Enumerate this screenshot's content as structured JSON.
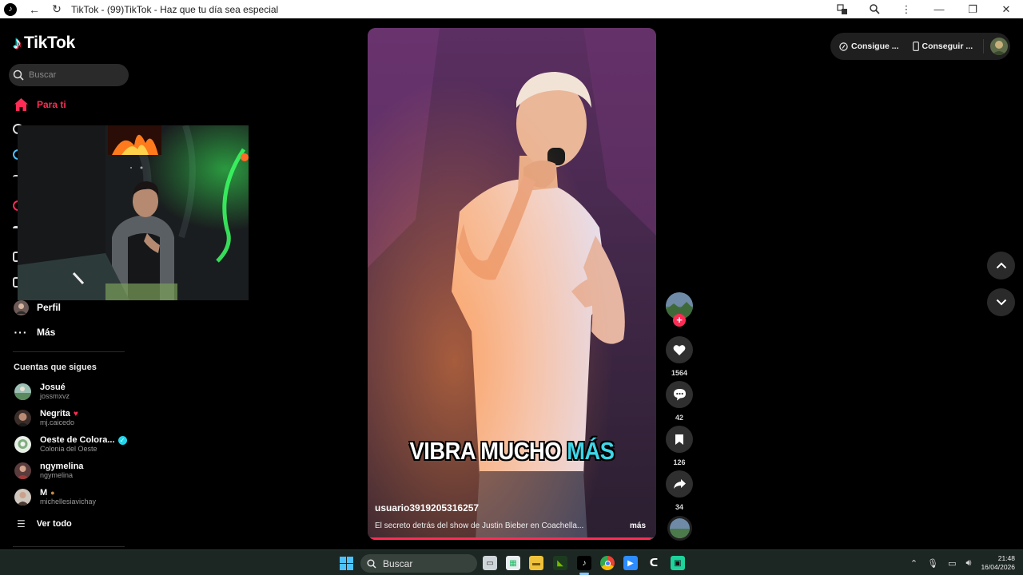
{
  "window": {
    "title": "TikTok - (99)TikTok - Haz que tu día sea especial"
  },
  "brand": {
    "name": "TikTok"
  },
  "search": {
    "placeholder": "Buscar"
  },
  "nav": {
    "for_you": "Para ti",
    "profile": "Perfil",
    "more": "Más"
  },
  "following": {
    "title": "Cuentas que sigues",
    "accounts": [
      {
        "name": "Josué",
        "username": "jossmxvz"
      },
      {
        "name": "Negrita",
        "username": "mj.caicedo"
      },
      {
        "name": "Oeste de Colora...",
        "username": "Colonia del Oeste"
      },
      {
        "name": "ngymelina",
        "username": "ngymelina"
      },
      {
        "name": "M",
        "username": "michellesiavichay"
      }
    ],
    "see_all": "Ver todo"
  },
  "video": {
    "caption_main": "VIBRA MUCHO ",
    "caption_highlight": "MÁS",
    "username": "usuario3919205316257",
    "description": "El secreto detrás del show de Justin Bieber en Coachella...",
    "more": "más",
    "progress_fraction": 0.98
  },
  "actions": {
    "likes": "1564",
    "comments": "42",
    "saves": "126",
    "shares": "34"
  },
  "top_right": {
    "coins_label": "Consigue ...",
    "app_label": "Conseguir ..."
  },
  "taskbar": {
    "search": "Buscar",
    "time": "21:48",
    "date": "16/04/2026"
  },
  "colors": {
    "accent": "#fe2c55",
    "cyan": "#25f4ee",
    "caption_highlight": "#3fd6e8",
    "verified": "#20d5ec"
  }
}
